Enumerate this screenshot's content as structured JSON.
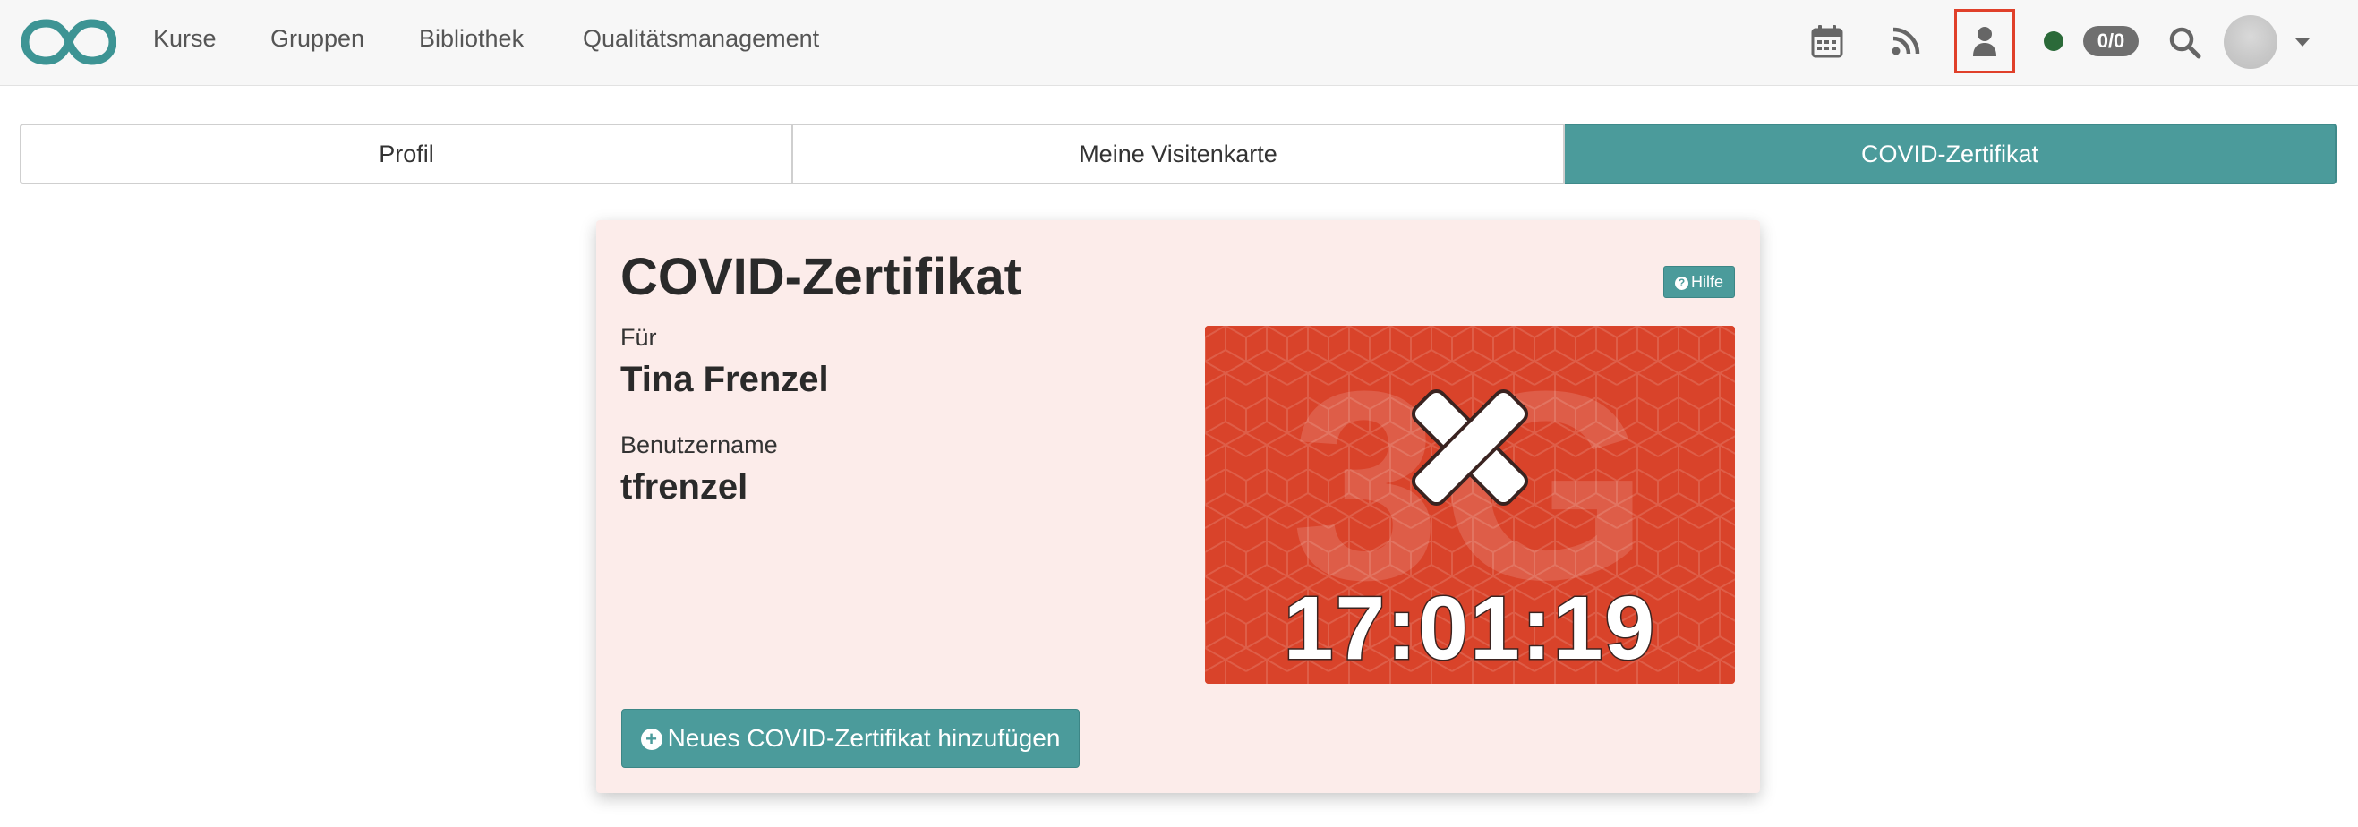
{
  "navbar": {
    "logo_icon": "infinity-logo-icon",
    "links": [
      "Kurse",
      "Gruppen",
      "Bibliothek",
      "Qualitätsmanagement"
    ],
    "icons": [
      "calendar-icon",
      "rss-icon",
      "user-icon",
      "status-dot",
      "search-icon",
      "avatar",
      "chevron-down-icon"
    ],
    "badge": "0/0",
    "status_color": "#2b6a39"
  },
  "tabs": [
    {
      "label": "Profil",
      "active": false
    },
    {
      "label": "Meine Visitenkarte",
      "active": false
    },
    {
      "label": "COVID-Zertifikat",
      "active": true
    }
  ],
  "card": {
    "title": "COVID-Zertifikat",
    "help_label": "Hilfe",
    "for_label": "Für",
    "name": "Tina Frenzel",
    "username_label": "Benutzername",
    "username": "tfrenzel",
    "certificate": {
      "watermark": "3G",
      "time": "17:01:19",
      "status_icon": "cross-icon",
      "tile_color": "#d9432a"
    },
    "add_button": "Neues COVID-Zertifikat hinzufügen"
  },
  "colors": {
    "accent": "#4b9b9b",
    "card_bg": "#fcecea",
    "highlight": "#e0402a"
  }
}
